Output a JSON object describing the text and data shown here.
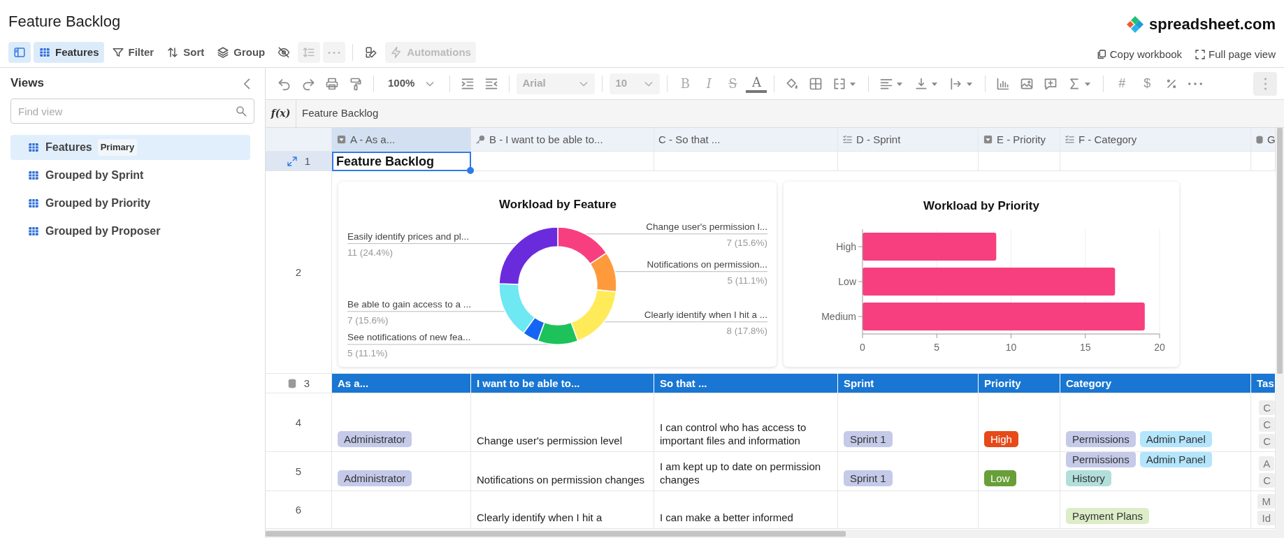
{
  "title": "Feature Backlog",
  "logo": {
    "text": "spreadsheet.com"
  },
  "toolbar": {
    "sidebar_toggle": {
      "selected": true
    },
    "view_button": {
      "label": "Features",
      "selected": true
    },
    "buttons": [
      {
        "kind": "filter",
        "label": "Filter",
        "disabled": false
      },
      {
        "kind": "sort",
        "label": "Sort",
        "disabled": false
      },
      {
        "kind": "group",
        "label": "Group",
        "disabled": false
      },
      {
        "kind": "hide",
        "disabled": false
      },
      {
        "kind": "row_height",
        "disabled": true
      },
      {
        "kind": "more",
        "disabled": true
      },
      {
        "kind": "format",
        "disabled": false
      },
      {
        "kind": "automations",
        "label": "Automations",
        "disabled": true
      }
    ]
  },
  "header_actions": [
    {
      "kind": "copy",
      "label": "Copy workbook"
    },
    {
      "kind": "fullscreen",
      "label": "Full page view"
    }
  ],
  "sidebar": {
    "title": "Views",
    "search": {
      "placeholder": "Find view"
    },
    "items": [
      {
        "label": "Features",
        "badge": "Primary",
        "selected": true
      },
      {
        "label": "Grouped by Sprint",
        "selected": false
      },
      {
        "label": "Grouped by Priority",
        "selected": false
      },
      {
        "label": "Grouped by Proposer",
        "selected": false
      }
    ]
  },
  "format_toolbar": {
    "zoom": "100%",
    "font": "Arial",
    "font_size": "10",
    "style_buttons": [
      "B",
      "I",
      "S",
      "A"
    ],
    "number_buttons": [
      "#",
      "$"
    ]
  },
  "formula_bar": {
    "label": "f(x)",
    "value": "Feature Backlog"
  },
  "grid": {
    "columns": [
      {
        "label": "A - As a...",
        "kind": "dropdown",
        "selected": true
      },
      {
        "label": "B - I want to be able to...",
        "kind": "key",
        "selected": false
      },
      {
        "label": "C - So that ...",
        "kind": "text",
        "selected": false
      },
      {
        "label": "D - Sprint",
        "kind": "list",
        "selected": false
      },
      {
        "label": "E - Priority",
        "kind": "dropdown",
        "selected": false
      },
      {
        "label": "F - Category",
        "kind": "list",
        "selected": false
      },
      {
        "label": "G",
        "kind": "lookup",
        "selected": false
      }
    ],
    "rows": [
      {
        "number": "1",
        "kind": "title",
        "selected": true,
        "text": "Feature Backlog"
      },
      {
        "number": "2",
        "kind": "charts",
        "selected": false,
        "charts": [
          {
            "chart_data": {
              "type": "donut",
              "title": "Workload by Feature",
              "categories": [
                "Change user's permission l...",
                "Notifications on permission...",
                "Clearly identify when I hit a ...",
                "See notifications of new fea...",
                null,
                "Be able to gain access to a ...",
                "Easily identify prices and pl..."
              ],
              "values": [
                7,
                5,
                8,
                5,
                2,
                7,
                11
              ],
              "value_labels": [
                "7 (15.6%)",
                "5 (11.1%)",
                "8 (17.8%)",
                "5 (11.1%)",
                null,
                "7 (15.6%)",
                "11 (24.4%)"
              ],
              "colors": [
                "#f73f7f",
                "#ff9a3c",
                "#ffeb5a",
                "#1ec25a",
                "#1565f5",
                "#6ee8f2",
                "#6a2bdc"
              ]
            }
          },
          {
            "chart_data": {
              "type": "bar",
              "orientation": "horizontal",
              "title": "Workload by Priority",
              "categories": [
                "High",
                "Low",
                "Medium"
              ],
              "series": [
                {
                  "color": "#f73f7f",
                  "values": [
                    9,
                    17,
                    19
                  ]
                }
              ],
              "xlim": [
                0,
                20
              ],
              "xticks": [
                0,
                5,
                10,
                15,
                20
              ],
              "grid": true
            }
          }
        ]
      },
      {
        "number": "3",
        "kind": "header",
        "selected": false,
        "cells": [
          "As a...",
          "I want to be able to...",
          "So that ...",
          "Sprint",
          "Priority",
          "Category",
          "Tas"
        ]
      },
      {
        "number": "4",
        "kind": "record",
        "selected": false,
        "cells": [
          {
            "tags": [
              {
                "label": "Administrator",
                "color": "#c5cae9"
              }
            ]
          },
          {
            "text": "Change user's permission level"
          },
          {
            "text": "I can control who has access to important files and information"
          },
          {
            "tags": [
              {
                "label": "Sprint 1",
                "color": "#c5cae9"
              }
            ]
          },
          {
            "tags": [
              {
                "label": "High",
                "color": "#e64a19"
              }
            ]
          },
          {
            "tags": [
              {
                "label": "Permissions",
                "color": "#c5cae9"
              },
              {
                "label": "Admin Panel",
                "color": "#b3e5fc"
              }
            ]
          },
          {
            "tags": [
              {
                "label": "C",
                "color": "#eeeeee"
              },
              {
                "label": "C",
                "color": "#eeeeee"
              },
              {
                "label": "C",
                "color": "#eeeeee"
              }
            ]
          }
        ]
      },
      {
        "number": "5",
        "kind": "record",
        "selected": false,
        "cells": [
          {
            "tags": [
              {
                "label": "Administrator",
                "color": "#c5cae9"
              }
            ]
          },
          {
            "text": "Notifications on permission changes"
          },
          {
            "text": "I am kept up to date on permission changes"
          },
          {
            "tags": [
              {
                "label": "Sprint 1",
                "color": "#c5cae9"
              }
            ]
          },
          {
            "tags": [
              {
                "label": "Low",
                "color": "#689f38"
              }
            ]
          },
          {
            "tags": [
              {
                "label": "Permissions",
                "color": "#c5cae9"
              },
              {
                "label": "Admin Panel",
                "color": "#b3e5fc"
              },
              {
                "label": "History",
                "color": "#b2dfdb"
              }
            ]
          },
          {
            "tags": [
              {
                "label": "A",
                "color": "#eeeeee"
              },
              {
                "label": "C",
                "color": "#eeeeee"
              }
            ]
          }
        ]
      },
      {
        "number": "6",
        "kind": "record",
        "selected": false,
        "cells": [
          null,
          {
            "text": "Clearly identify when I hit a"
          },
          {
            "text": "I can make a better informed"
          },
          null,
          null,
          {
            "tags": [
              {
                "label": "Payment Plans",
                "color": "#dcedc8"
              }
            ]
          },
          {
            "tags": [
              {
                "label": "M",
                "color": "#eeeeee"
              },
              {
                "label": "Id",
                "color": "#eeeeee"
              }
            ]
          }
        ]
      }
    ]
  }
}
